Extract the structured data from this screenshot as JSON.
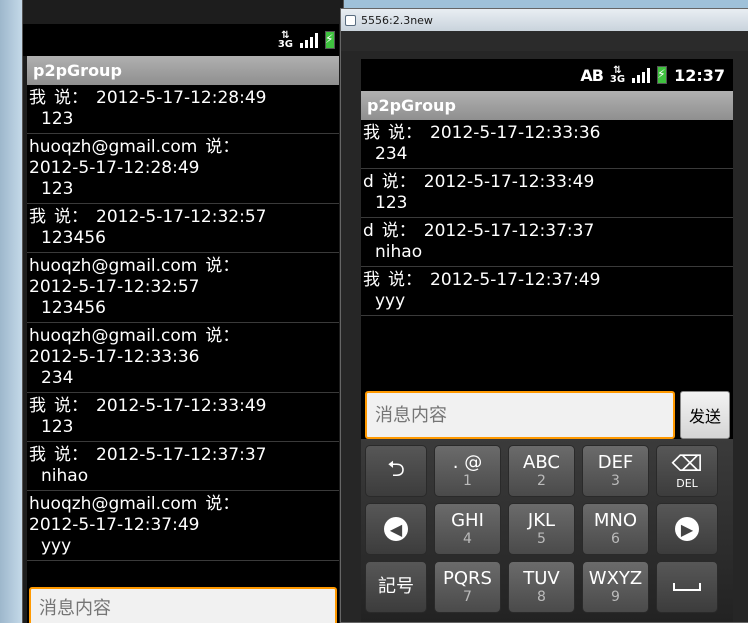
{
  "left_emulator": {
    "app_title": "p2pGroup",
    "messages": [
      {
        "sender": "我",
        "says": "说：",
        "time": "2012-5-17-12:28:49",
        "text": "123"
      },
      {
        "sender": "huoqzh@gmail.com",
        "says": "说：",
        "time": "2012-5-17-12:28:49",
        "text": "123"
      },
      {
        "sender": "我",
        "says": "说：",
        "time": "2012-5-17-12:32:57",
        "text": "123456"
      },
      {
        "sender": "huoqzh@gmail.com",
        "says": "说：",
        "time": "2012-5-17-12:32:57",
        "text": "123456"
      },
      {
        "sender": "huoqzh@gmail.com",
        "says": "说：",
        "time": "2012-5-17-12:33:36",
        "text": "234"
      },
      {
        "sender": "我",
        "says": "说：",
        "time": "2012-5-17-12:33:49",
        "text": "123"
      },
      {
        "sender": "我",
        "says": "说：",
        "time": "2012-5-17-12:37:37",
        "text": "nihao"
      },
      {
        "sender": "huoqzh@gmail.com",
        "says": "说：",
        "time": "2012-5-17-12:37:49",
        "text": "yyy"
      }
    ],
    "input_placeholder": "消息内容"
  },
  "right_emulator": {
    "window_title": "5556:2.3new",
    "status": {
      "clock": "12:37",
      "input_mode": "AB",
      "network": "3G"
    },
    "app_title": "p2pGroup",
    "messages": [
      {
        "sender": "我",
        "says": "说：",
        "time": "2012-5-17-12:33:36",
        "text": "234"
      },
      {
        "sender": "d",
        "says": "说：",
        "time": "2012-5-17-12:33:49",
        "text": "123"
      },
      {
        "sender": "d",
        "says": "说：",
        "time": "2012-5-17-12:37:37",
        "text": "nihao"
      },
      {
        "sender": "我",
        "says": "说：",
        "time": "2012-5-17-12:37:49",
        "text": "yyy"
      }
    ],
    "input_placeholder": "消息内容",
    "send_label": "发送",
    "keyboard": {
      "row1": [
        {
          "icon": "back-arrow-icon",
          "glyph": "⮌"
        },
        {
          "main": ". @",
          "sub": "1"
        },
        {
          "main": "ABC",
          "sub": "2"
        },
        {
          "main": "DEF",
          "sub": "3"
        },
        {
          "icon": "backspace-icon",
          "glyph": "⌫",
          "label": "DEL"
        }
      ],
      "row2": [
        {
          "icon": "arrow-left-icon",
          "glyph": "◀"
        },
        {
          "main": "GHI",
          "sub": "4"
        },
        {
          "main": "JKL",
          "sub": "5"
        },
        {
          "main": "MNO",
          "sub": "6"
        },
        {
          "icon": "arrow-right-icon",
          "glyph": "▶"
        }
      ],
      "row3": [
        {
          "main": "記号"
        },
        {
          "main": "PQRS",
          "sub": "7"
        },
        {
          "main": "TUV",
          "sub": "8"
        },
        {
          "main": "WXYZ",
          "sub": "9"
        },
        {
          "icon": "space-icon"
        }
      ]
    }
  },
  "colors": {
    "accent_focus": "#ff9900",
    "title_bar": "#9a9a9a",
    "battery": "#3fc23f"
  }
}
